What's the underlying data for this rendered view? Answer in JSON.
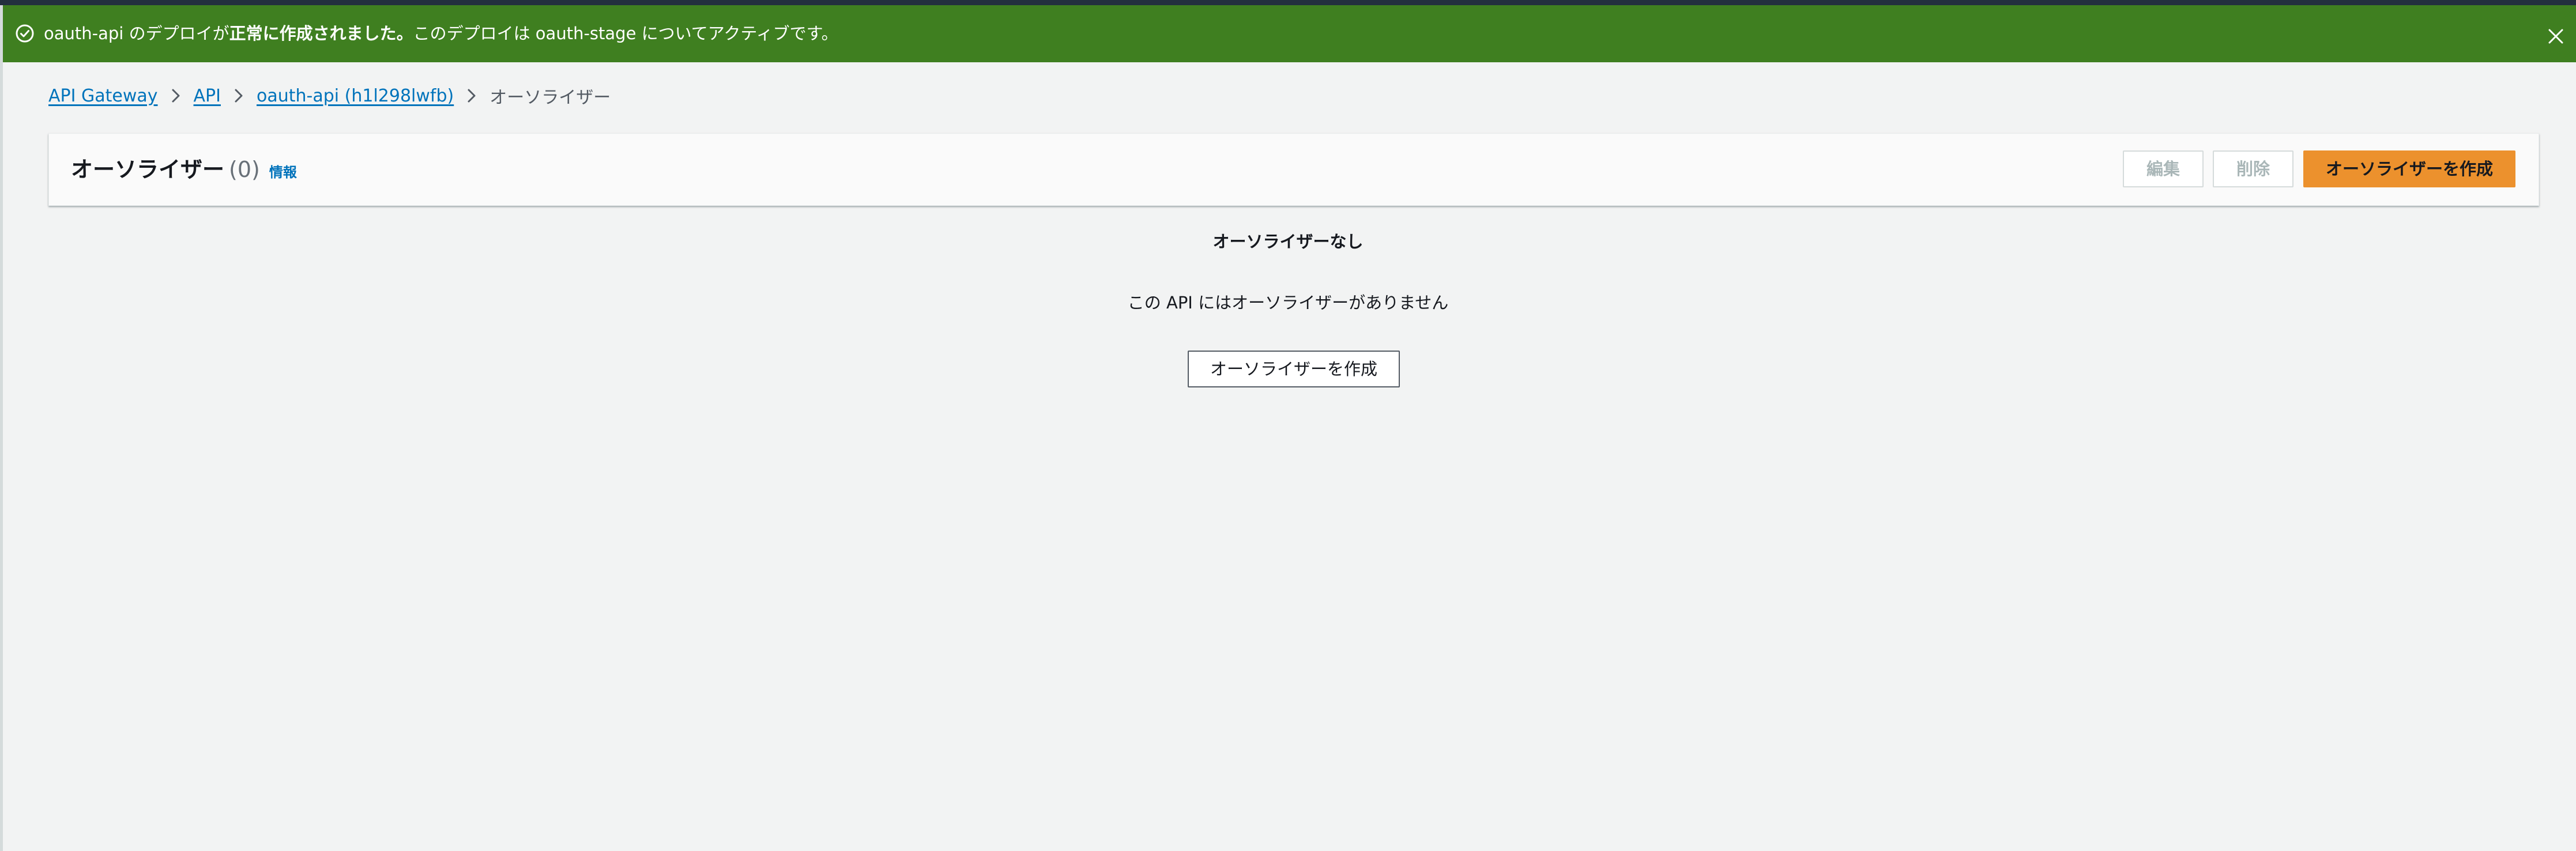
{
  "flash": {
    "part1": "oauth-api のデプロイが",
    "part2": "正常に作成されました。",
    "part3": "このデプロイは oauth-stage についてアクティブです。",
    "icon": "success-check-icon",
    "close_icon": "close-icon",
    "color": "#3f7f20"
  },
  "breadcrumb": {
    "items": [
      "API Gateway",
      "API",
      "oauth-api (h1l298lwfb)"
    ],
    "current": "オーソライザー"
  },
  "header": {
    "title": "オーソライザー",
    "count": "(0)",
    "info": "情報",
    "edit_label": "編集",
    "delete_label": "削除",
    "create_label": "オーソライザーを作成"
  },
  "empty": {
    "title": "オーソライザーなし",
    "message": "この API にはオーソライザーがありません",
    "create_label": "オーソライザーを作成"
  },
  "colors": {
    "accent": "#ec912d",
    "link": "#0073bb",
    "background": "#f2f3f3"
  }
}
